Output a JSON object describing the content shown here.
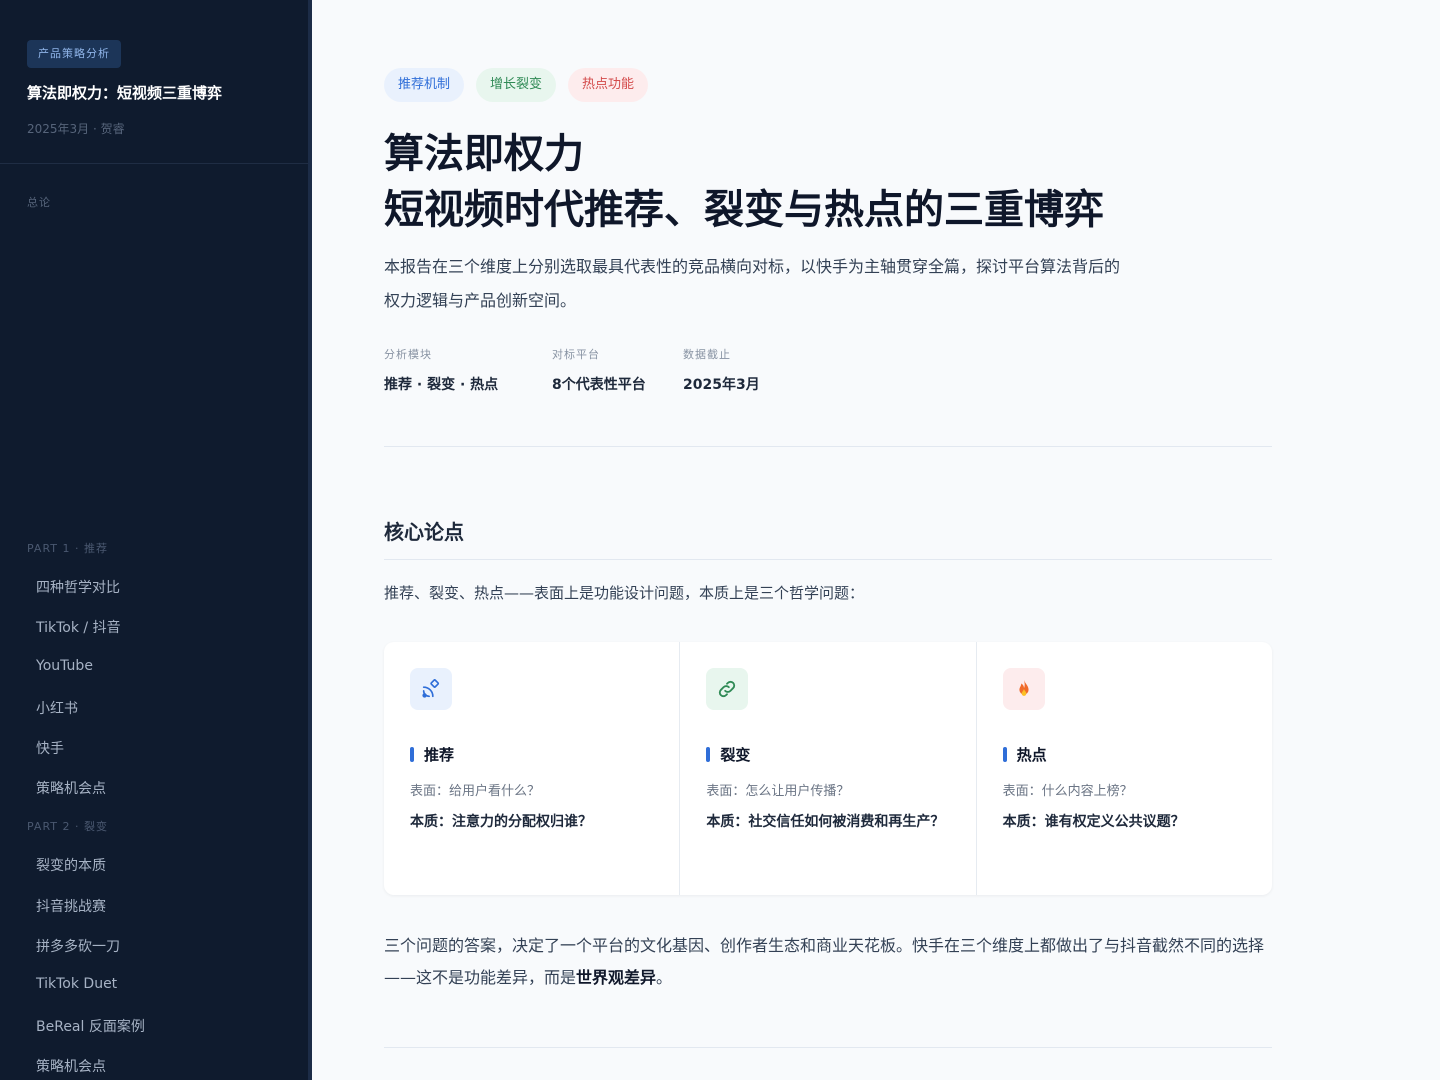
{
  "sidebar": {
    "badge": "产品策略分析",
    "title": "算法即权力：短视频三重博弈",
    "meta": "2025年3月 · 贺睿",
    "overview": "总论",
    "parts": [
      {
        "label": "PART 1 · 推荐",
        "items": [
          "四种哲学对比",
          "TikTok / 抖音",
          "YouTube",
          "小红书",
          "快手",
          "策略机会点"
        ]
      },
      {
        "label": "PART 2 · 裂变",
        "items": [
          "裂变的本质",
          "抖音挑战赛",
          "拼多多砍一刀",
          "TikTok Duet",
          "BeReal 反面案例",
          "策略机会点"
        ]
      }
    ]
  },
  "main": {
    "tags": [
      {
        "label": "推荐机制",
        "color": "#2f6ed8"
      },
      {
        "label": "增长裂变",
        "color": "#2f8a55"
      },
      {
        "label": "热点功能",
        "color": "#d34a4a"
      }
    ],
    "title_line1": "算法即权力",
    "title_line2": "短视频时代推荐、裂变与热点的三重博弈",
    "lead": "本报告在三个维度上分别选取最具代表性的竞品横向对标，以快手为主轴贯穿全篇，探讨平台算法背后的权力逻辑与产品创新空间。",
    "meta": [
      {
        "label": "分析模块",
        "value": "推荐 · 裂变 · 热点"
      },
      {
        "label": "对标平台",
        "value": "8个代表性平台"
      },
      {
        "label": "数据截止",
        "value": "2025年3月"
      }
    ],
    "section_title": "核心论点",
    "intro": "推荐、裂变、热点——表面上是功能设计问题，本质上是三个哲学问题：",
    "cards": [
      {
        "icon": "satellite-icon",
        "heading": "推荐",
        "surface": "表面：给用户看什么？",
        "essence": "本质：注意力的分配权归谁？"
      },
      {
        "icon": "link-icon",
        "heading": "裂变",
        "surface": "表面：怎么让用户传播？",
        "essence": "本质：社交信任如何被消费和再生产？"
      },
      {
        "icon": "fire-icon",
        "heading": "热点",
        "surface": "表面：什么内容上榜？",
        "essence": "本质：谁有权定义公共议题？"
      }
    ],
    "conclusion_part1": "三个问题的答案，决定了一个平台的文化基因、创作者生态和商业天花板。快手在三个维度上都做出了与抖音截然不同的选择——这不是功能差异，而是",
    "conclusion_bold": "世界观差异",
    "conclusion_end": "。"
  }
}
